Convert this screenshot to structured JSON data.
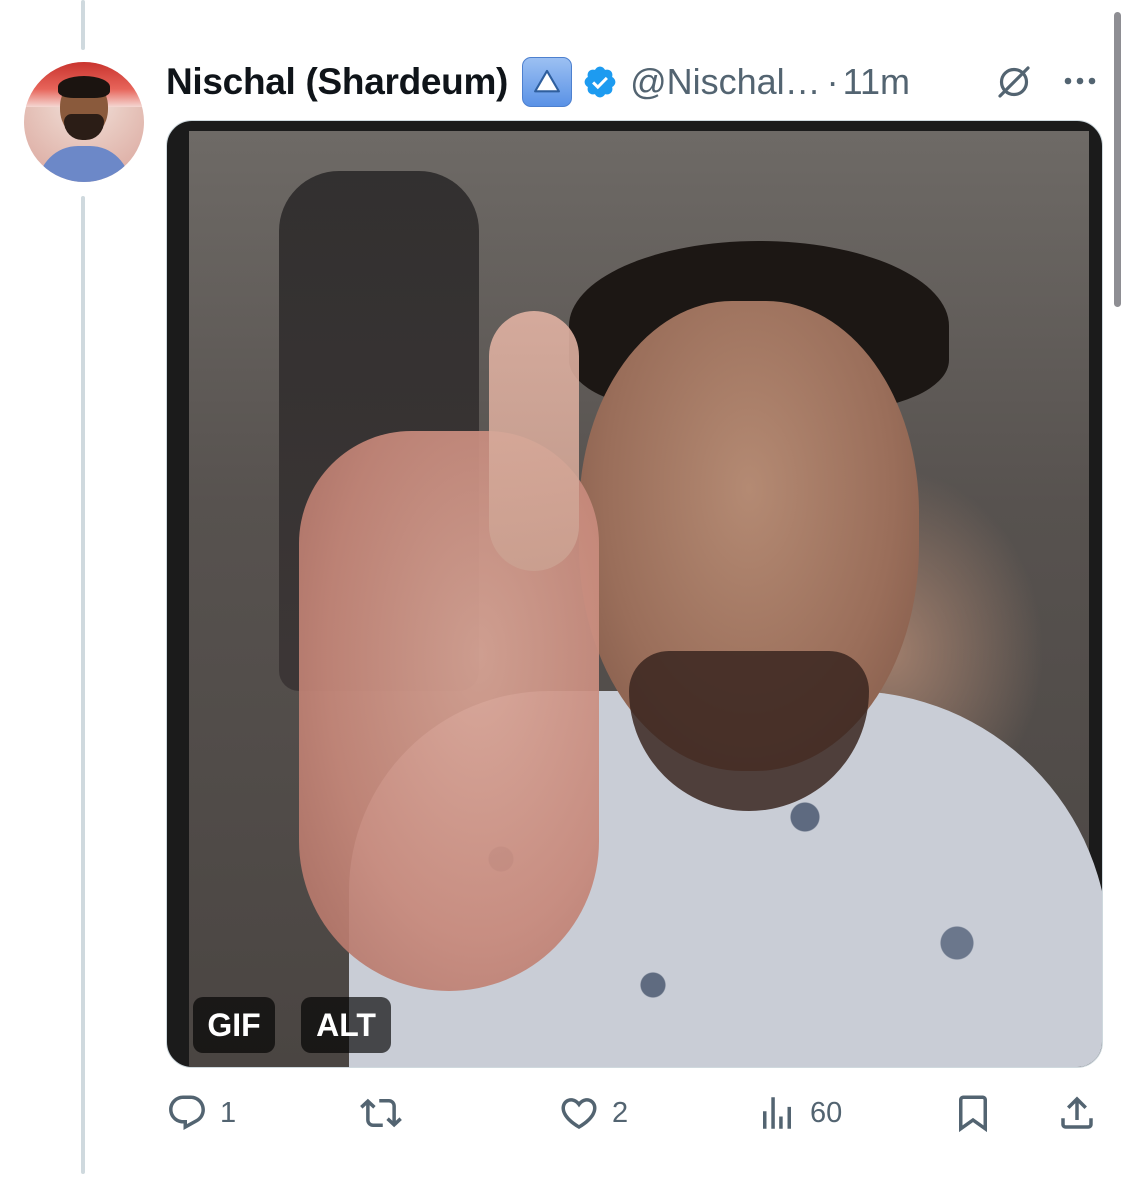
{
  "tweet": {
    "author_name": "Nischal (Shardeum)",
    "handle": "@Nischal…",
    "separator": "·",
    "time": "11m"
  },
  "media": {
    "gif_label": "GIF",
    "alt_label": "ALT"
  },
  "actions": {
    "reply_count": "1",
    "retweet_count": "",
    "like_count": "2",
    "views_count": "60"
  },
  "icons": {
    "reply": "reply-icon",
    "retweet": "retweet-icon",
    "like": "heart-icon",
    "views": "views-icon",
    "bookmark": "bookmark-icon",
    "share": "share-icon",
    "grok": "grok-icon",
    "more": "more-icon",
    "verified": "verified-icon",
    "triangle": "triangle-badge-icon"
  },
  "colors": {
    "accent": "#1d9bf0",
    "secondary_text": "#536471",
    "primary_text": "#0f1419"
  }
}
